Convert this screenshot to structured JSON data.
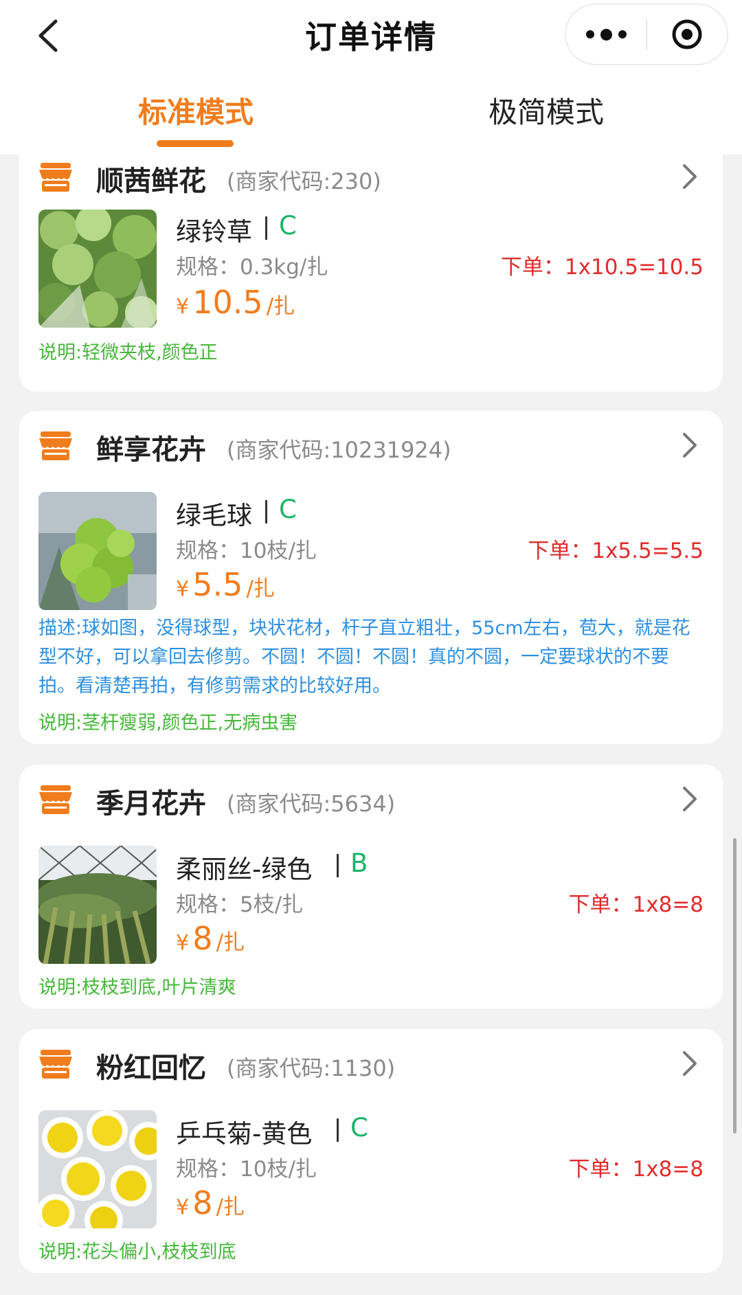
{
  "nav": {
    "title": "订单详情",
    "back_icon": "chevron-left-icon",
    "more_icon": "more-dots-icon",
    "close_icon": "target-circle-icon"
  },
  "tabs": [
    {
      "label": "标准模式",
      "active": true
    },
    {
      "label": "极简模式",
      "active": false
    }
  ],
  "colors": {
    "accent": "#f07d1d",
    "order_red": "#e02d2d",
    "grade_green": "#19b46a",
    "note_green": "#46b83a",
    "desc_blue": "#2e8fe0"
  },
  "shops": [
    {
      "name": "顺茜鲜花",
      "code": "(商家代码:230)",
      "product": {
        "name": "绿铃草",
        "grade": "C",
        "spec": "规格：0.3kg/扎",
        "order": "下单：1x10.5=10.5",
        "price_symbol": "¥",
        "price": "10.5",
        "unit": "/扎",
        "note": "说明:轻微夹枝,颜色正"
      }
    },
    {
      "name": "鲜享花卉",
      "code": "(商家代码:10231924)",
      "product": {
        "name": "绿毛球",
        "grade": "C",
        "spec": "规格：10枝/扎",
        "order": "下单：1x5.5=5.5",
        "price_symbol": "¥",
        "price": "5.5",
        "unit": "/扎",
        "description_lines": [
          "描述:球如图，没得球型，块状花材，杆子直立粗壮，55cm左右，苞大，就是花",
          "型不好，可以拿回去修剪。不圆！不圆！不圆！真的不圆，一定要球状的不要",
          "拍。看清楚再拍，有修剪需求的比较好用。"
        ],
        "note": "说明:茎杆瘦弱,颜色正,无病虫害"
      }
    },
    {
      "name": "季月花卉",
      "code": "(商家代码:5634)",
      "product": {
        "name": "柔丽丝-绿色",
        "grade": "B",
        "spec": "规格：5枝/扎",
        "order": "下单：1x8=8",
        "price_symbol": "¥",
        "price": "8",
        "unit": "/扎",
        "note": "说明:枝枝到底,叶片清爽"
      }
    },
    {
      "name": "粉红回忆",
      "code": "(商家代码:1130)",
      "product": {
        "name": "乒乓菊-黄色",
        "grade": "C",
        "spec": "规格：10枝/扎",
        "order": "下单：1x8=8",
        "price_symbol": "¥",
        "price": "8",
        "unit": "/扎",
        "note": "说明:花头偏小,枝枝到底"
      }
    }
  ]
}
